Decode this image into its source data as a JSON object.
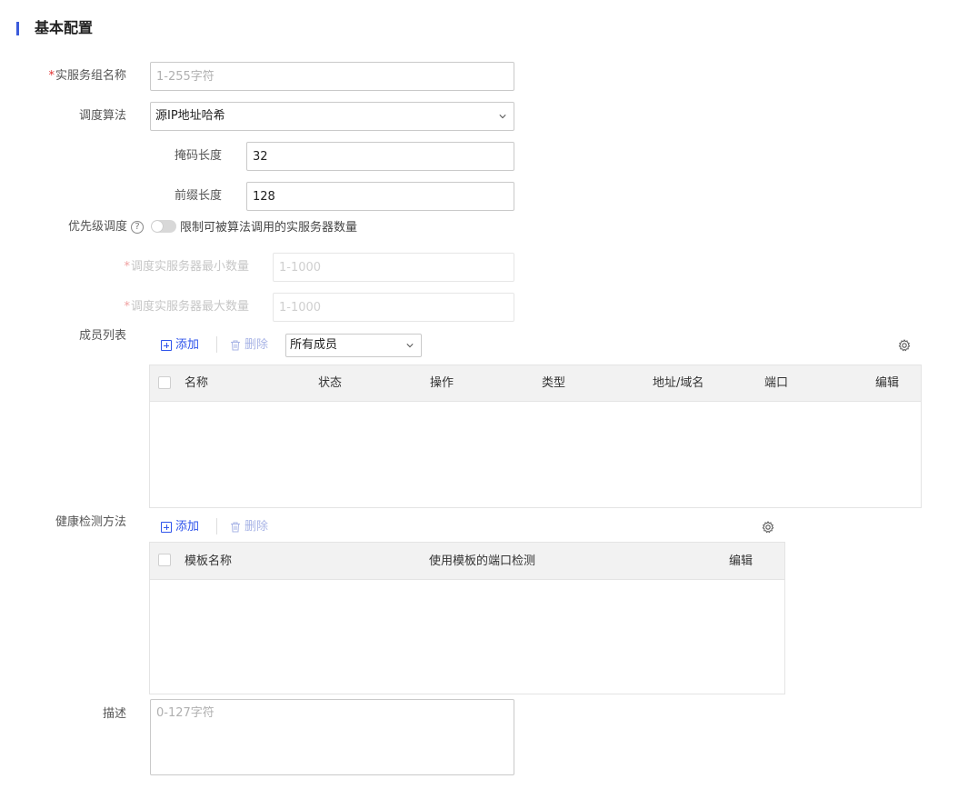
{
  "section": {
    "title": "基本配置"
  },
  "form": {
    "group_name": {
      "required_mark": "*",
      "label": "实服务组名称",
      "placeholder": "1-255字符",
      "value": ""
    },
    "algorithm": {
      "label": "调度算法",
      "selected": "源IP地址哈希"
    },
    "mask_length": {
      "label": "掩码长度",
      "value": "32"
    },
    "prefix_length": {
      "label": "前缀长度",
      "value": "128"
    },
    "priority": {
      "label": "优先级调度",
      "help": "?",
      "toggle_text": "限制可被算法调用的实服务器数量",
      "enabled": false
    },
    "min_count": {
      "required_mark": "*",
      "label": "调度实服务器最小数量",
      "placeholder": "1-1000"
    },
    "max_count": {
      "required_mark": "*",
      "label": "调度实服务器最大数量",
      "placeholder": "1-1000"
    },
    "description": {
      "label": "描述",
      "placeholder": "0-127字符"
    }
  },
  "members": {
    "label": "成员列表",
    "add_label": "添加",
    "delete_label": "删除",
    "filter_selected": "所有成员",
    "columns": [
      "名称",
      "状态",
      "操作",
      "类型",
      "地址/域名",
      "端口",
      "编辑"
    ],
    "rows": []
  },
  "health": {
    "label": "健康检测方法",
    "add_label": "添加",
    "delete_label": "删除",
    "columns": [
      "模板名称",
      "使用模板的端口检测",
      "编辑"
    ],
    "rows": []
  }
}
